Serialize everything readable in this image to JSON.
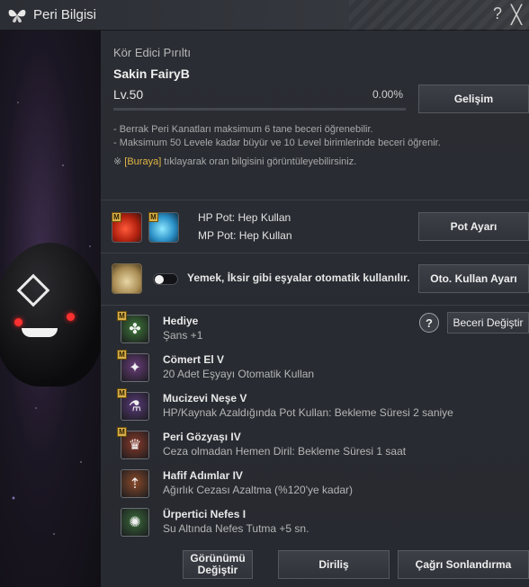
{
  "window": {
    "title": "Peri Bilgisi",
    "help_glyph": "?",
    "close_glyph": "╳"
  },
  "fairy": {
    "subtitle": "Kör Edici Pırıltı",
    "name": "Sakin FairyB",
    "level": "Lv.50",
    "exp": "0.00%",
    "exp_fraction": 0.0,
    "evolve_label": "Gelişim"
  },
  "notes": {
    "line1": "- Berrak Peri Kanatları maksimum 6 tane beceri öğrenebilir.",
    "line2": "- Maksimum 50 Levele kadar büyür ve 10 Level birimlerinde beceri öğrenir.",
    "line3_prefix": "※ ",
    "line3_link": "[Buraya]",
    "line3_suffix": " tıklayarak oran bilgisini görüntüleyebilirsiniz."
  },
  "potions": {
    "badge": "M",
    "hp": "HP Pot: Hep Kullan",
    "mp": "MP Pot: Hep Kullan",
    "button": "Pot Ayarı"
  },
  "auto_use": {
    "text": "Yemek, İksir gibi eşyalar otomatik kullanılır.",
    "enabled": false,
    "button": "Oto. Kullan Ayarı"
  },
  "skills_header": {
    "info_glyph": "?",
    "change_button": "Beceri Değiştir"
  },
  "skills": [
    {
      "name": "Hediye",
      "desc": "Şans +1",
      "badge": "M",
      "icon": "clover-icon",
      "color": "#3f7a3a"
    },
    {
      "name": "Cömert El V",
      "desc": "20 Adet Eşyayı Otomatik Kullan",
      "badge": "M",
      "icon": "fairy-icon",
      "color": "#6a3d7a"
    },
    {
      "name": "Mucizevi Neşe V",
      "desc": "HP/Kaynak Azaldığında Pot Kullan: Bekleme Süresi 2 saniye",
      "badge": "M",
      "icon": "potion-icon",
      "color": "#5a3a7a"
    },
    {
      "name": "Peri Gözyaşı IV",
      "desc": "Ceza olmadan Hemen Diril: Bekleme Süresi 1 saat",
      "badge": "M",
      "icon": "tear-icon",
      "color": "#8a3a2a"
    },
    {
      "name": "Hafif Adımlar IV",
      "desc": "Ağırlık Cezası Azaltma (%120'ye kadar)",
      "badge": "",
      "icon": "bag-icon",
      "color": "#8a4a2a"
    },
    {
      "name": "Ürpertici Nefes I",
      "desc": "Su Altında Nefes Tutma +5 sn.",
      "badge": "",
      "icon": "breath-icon",
      "color": "#3a6a3a"
    }
  ],
  "footer": {
    "appearance_line1": "Görünümü",
    "appearance_line2": "Değiştir",
    "revive": "Diriliş",
    "recall_end": "Çağrı Sonlandırma"
  }
}
